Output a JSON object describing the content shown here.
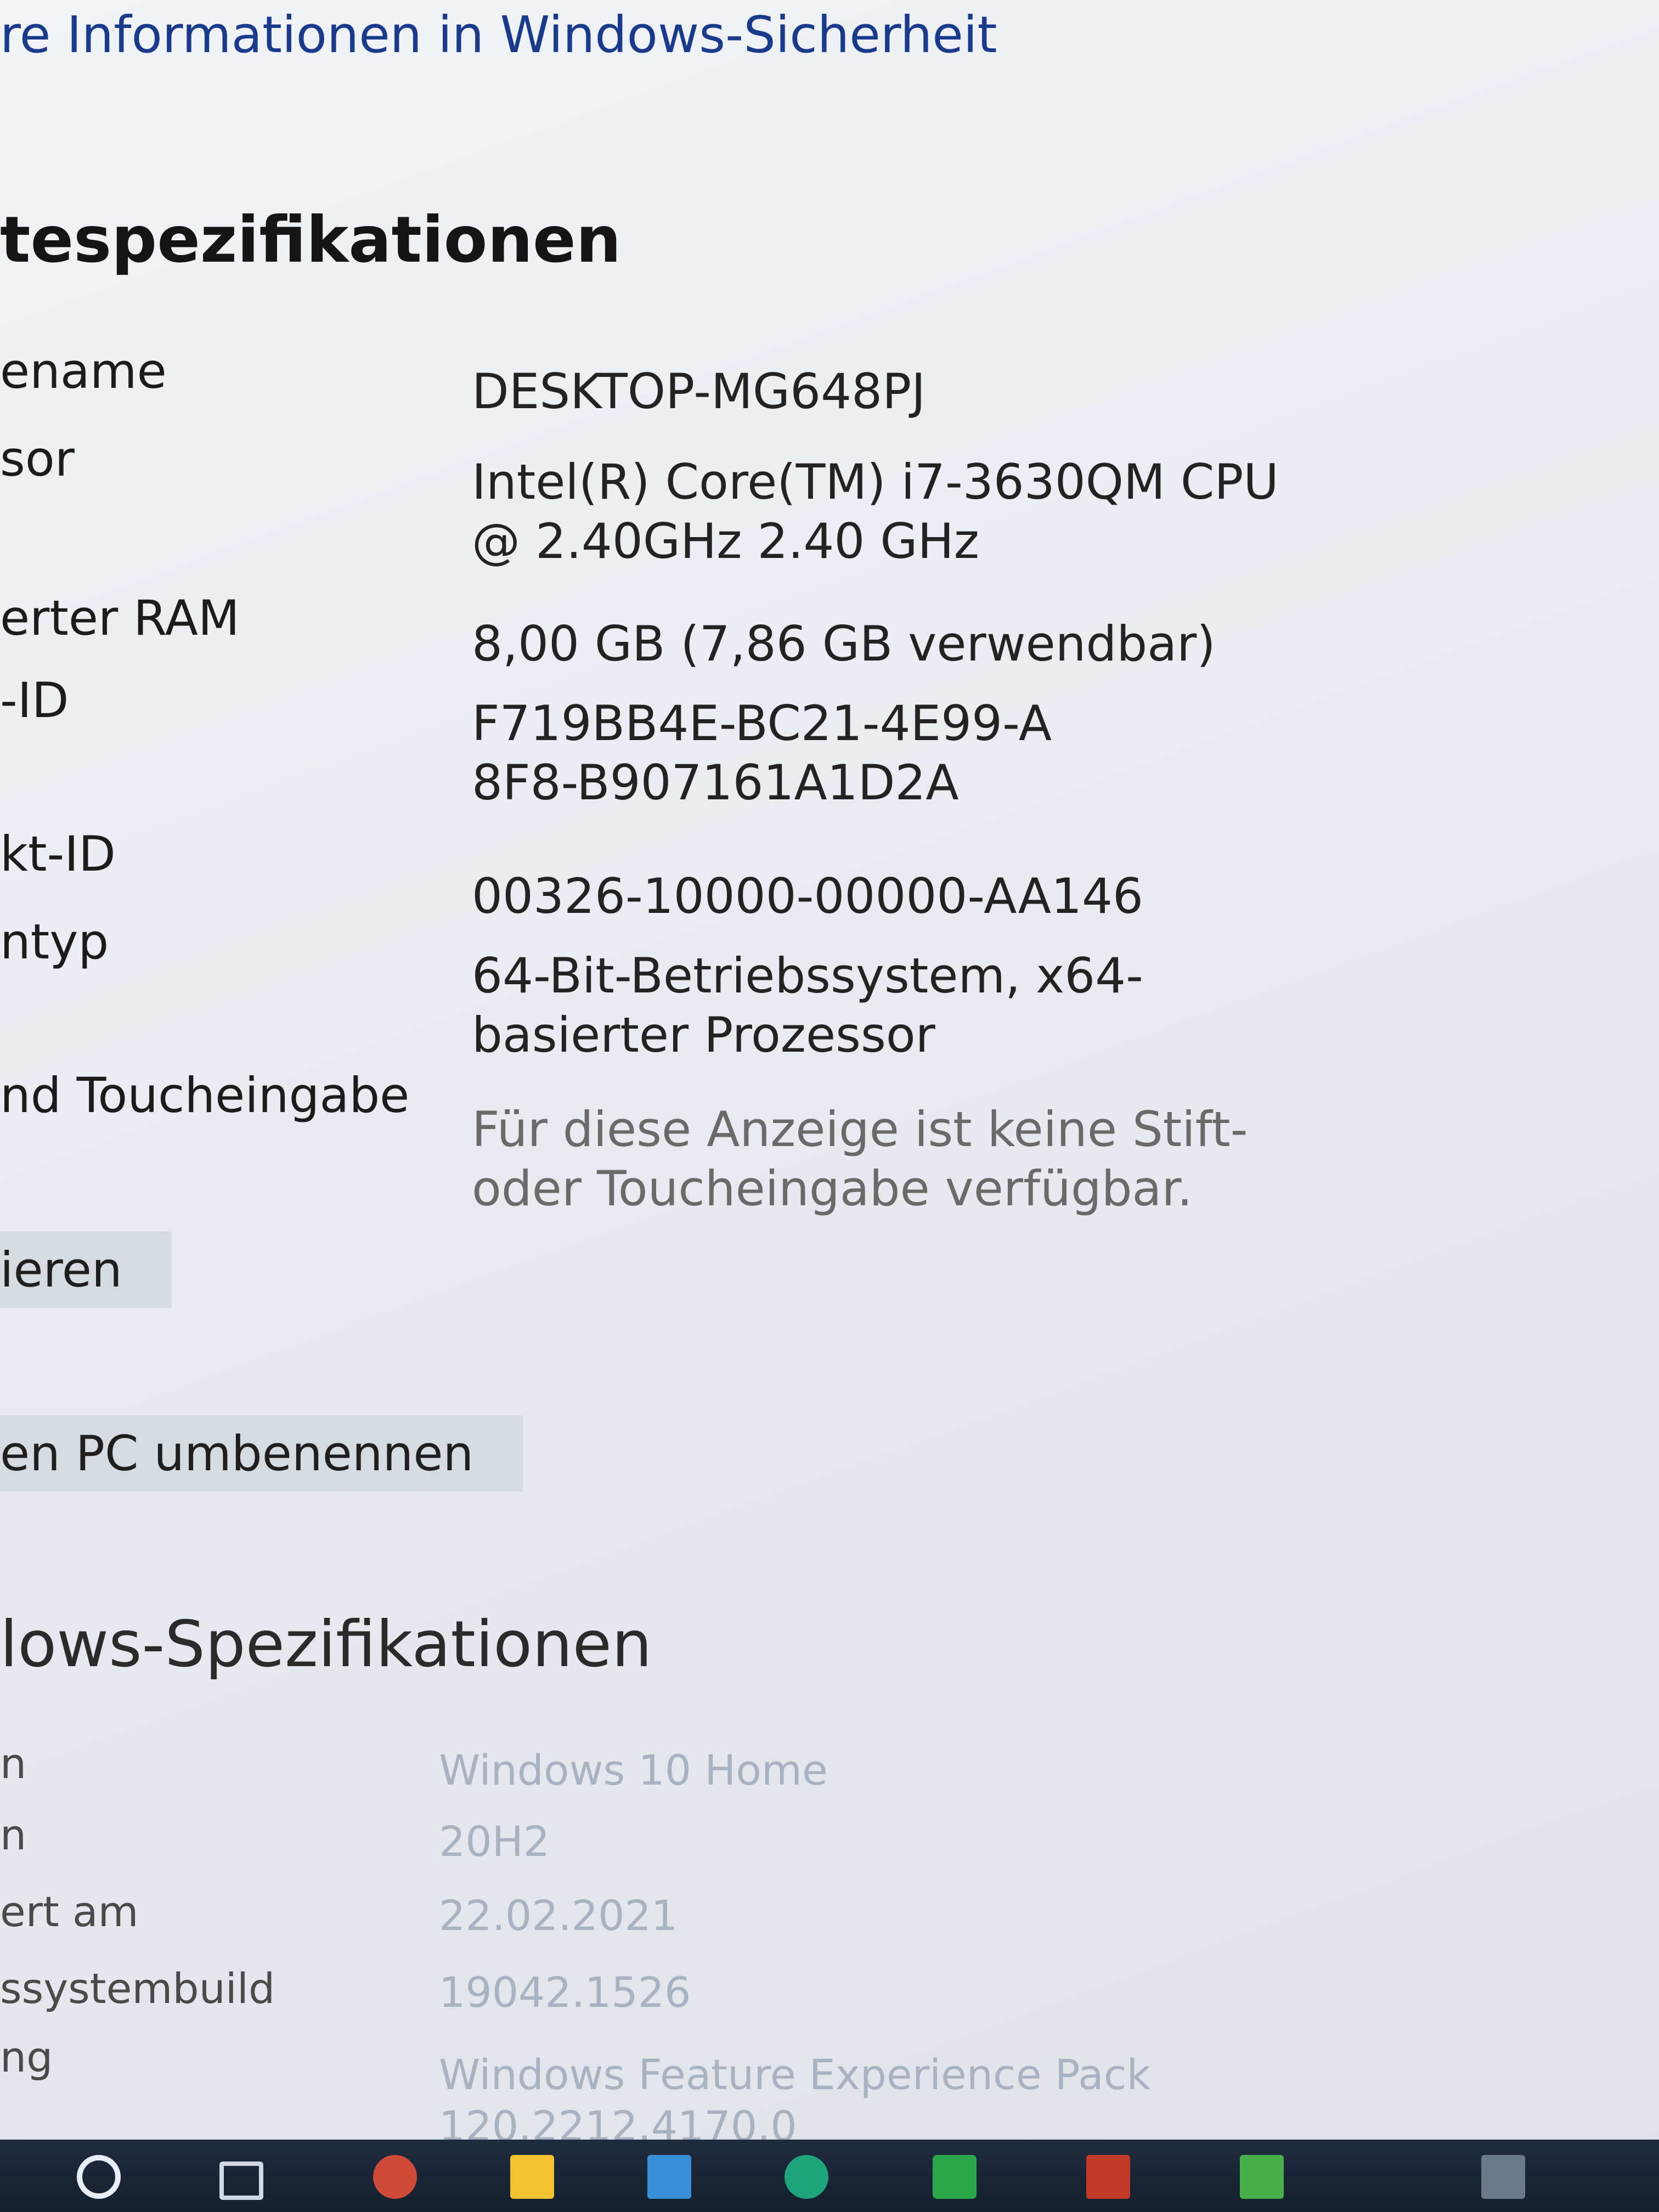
{
  "top_link": "re Informationen in Windows-Sicherheit",
  "device_specs": {
    "heading": "tespezifikationen",
    "rows": [
      {
        "label": "ename",
        "value": "DESKTOP-MG648PJ"
      },
      {
        "label": "sor",
        "value": "Intel(R) Core(TM) i7-3630QM CPU @ 2.40GHz   2.40 GHz"
      },
      {
        "label": "erter RAM",
        "value": "8,00 GB (7,86 GB verwendbar)"
      },
      {
        "label": "-ID",
        "value": "F719BB4E-BC21-4E99-A8F8-B907161A1D2A"
      },
      {
        "label": "kt-ID",
        "value": "00326-10000-00000-AA146"
      },
      {
        "label": "ntyp",
        "value": "64-Bit-Betriebssystem, x64-basierter Prozessor"
      },
      {
        "label": "nd Toucheingabe",
        "value": "Für diese Anzeige ist keine Stift- oder Toucheingabe verfügbar."
      }
    ],
    "copy_button": "ieren",
    "rename_button": "en PC umbenennen"
  },
  "windows_specs": {
    "heading": "lows-Spezifikationen",
    "rows": [
      {
        "label": "n",
        "value": "Windows 10 Home"
      },
      {
        "label": "n",
        "value": "20H2"
      },
      {
        "label": "ert am",
        "value": "22.02.2021"
      },
      {
        "label": "ssystembuild",
        "value": "19042.1526"
      },
      {
        "label": "ng",
        "value": "Windows Feature Experience Pack 120.2212.4170.0"
      }
    ]
  },
  "taskbar": {
    "icons": [
      "search-icon",
      "task-view-icon",
      "browser-icon",
      "file-explorer-icon",
      "store-icon",
      "app-icon",
      "spreadsheet-icon",
      "app-icon",
      "app-icon",
      "app-icon"
    ]
  }
}
